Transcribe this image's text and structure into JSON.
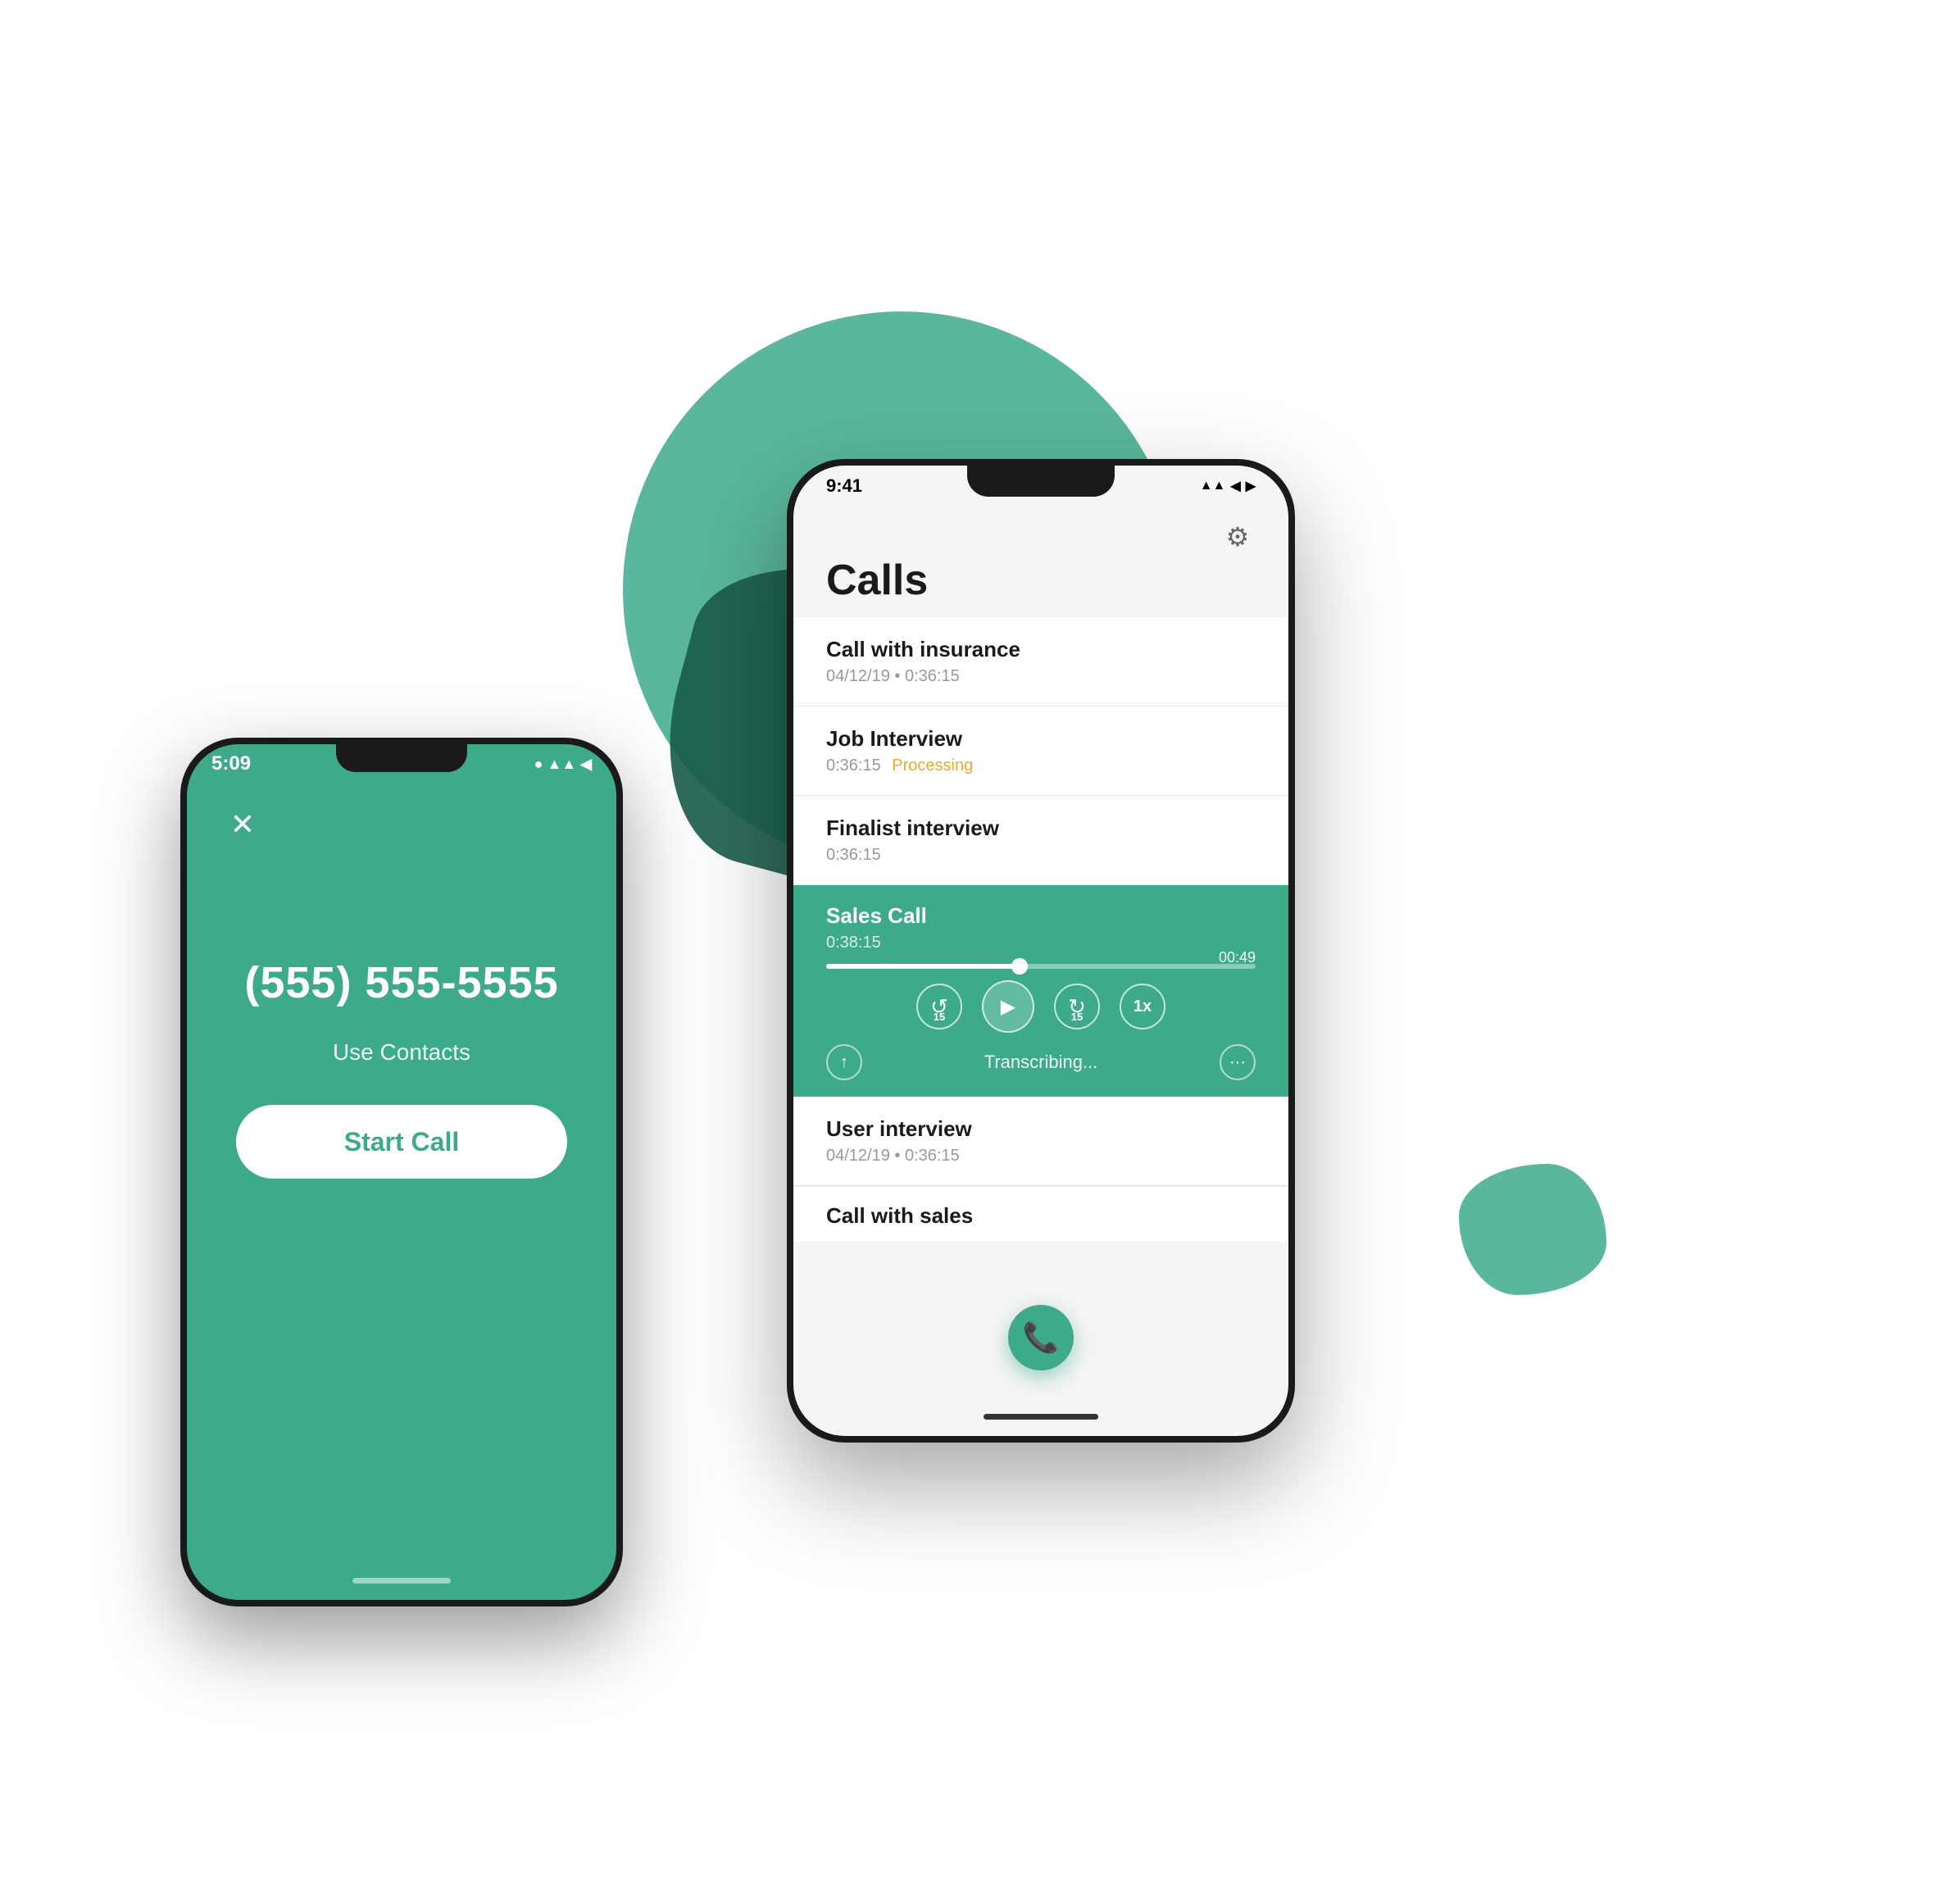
{
  "background": {
    "circle_color": "#3daa8c",
    "blob_color": "#1a5c4a",
    "blob_small_color": "#3daa8c",
    "yellow_line_color": "#d4e84a"
  },
  "left_phone": {
    "status_time": "5:09",
    "screen_bg": "#3daa8c",
    "close_icon": "✕",
    "phone_number": "(555) 555-5555",
    "use_contacts_label": "Use Contacts",
    "start_call_label": "Start Call"
  },
  "right_phone": {
    "status_time": "9:41",
    "status_icons": "▲▲ ◀ ▶",
    "settings_icon": "⚙",
    "page_title": "Calls",
    "calls": [
      {
        "title": "Call with insurance",
        "meta": "04/12/19  •  0:36:15",
        "status": ""
      },
      {
        "title": "Job Interview",
        "meta": "0:36:15",
        "status": "processing",
        "status_text": "Processing"
      },
      {
        "title": "Finalist interview",
        "meta": "0:36:15",
        "status": ""
      },
      {
        "title": "Sales Call",
        "meta": "0:38:15",
        "status": "active",
        "progress_time": "00:49",
        "progress_pct": 45,
        "rewind_label": "15",
        "play_icon": "▶",
        "forward_label": "15",
        "speed_label": "1x",
        "transcribing_text": "Transcribing...",
        "share_icon": "↑",
        "more_icon": "···"
      },
      {
        "title": "User interview",
        "meta": "04/12/19  •  0:36:15",
        "status": ""
      },
      {
        "title": "Call with sales",
        "meta": "",
        "status": ""
      }
    ],
    "fab_icon": "📞"
  }
}
